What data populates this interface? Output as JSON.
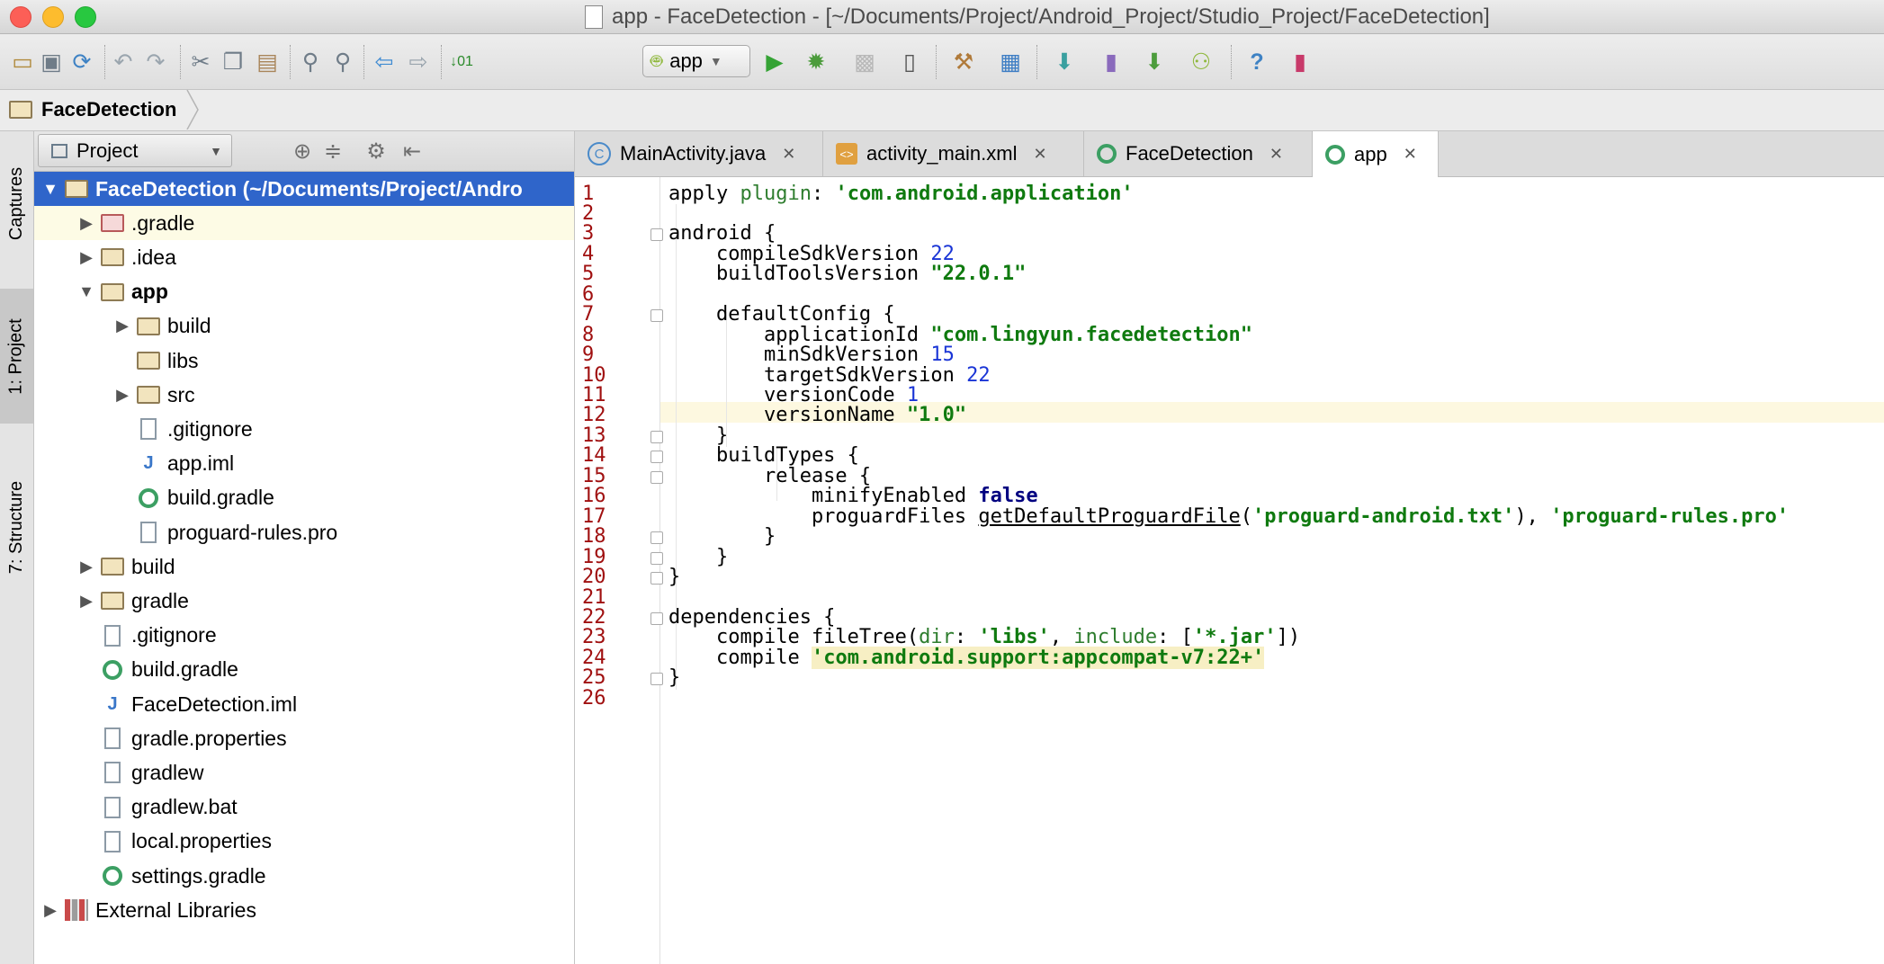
{
  "window": {
    "title": "app - FaceDetection - [~/Documents/Project/Android_Project/Studio_Project/FaceDetection]"
  },
  "toolbar": {
    "run_config": "app",
    "icons": [
      "open-folder-icon",
      "save-icon",
      "sync-icon",
      "undo-icon",
      "redo-icon",
      "cut-icon",
      "copy-icon",
      "paste-icon",
      "find-icon",
      "replace-icon",
      "back-icon",
      "forward-icon",
      "make-project-icon",
      "run-icon",
      "debug-icon",
      "attach-debugger-icon",
      "device-monitor-icon",
      "project-structure-icon",
      "sdk-manager-icon",
      "gradle-sync-icon",
      "avd-manager-icon",
      "sdk-download-icon",
      "android-icon",
      "help-icon",
      "android-device-monitor-icon"
    ]
  },
  "navbar": {
    "breadcrumb": "FaceDetection"
  },
  "side_tabs": [
    "Captures",
    "1: Project",
    "7: Structure"
  ],
  "project_panel": {
    "view_selector": "Project",
    "tree": [
      {
        "label": "FaceDetection (~/Documents/Project/Andro",
        "type": "module",
        "level": 0,
        "expanded": true,
        "selected": true
      },
      {
        "label": ".gradle",
        "type": "folder-red",
        "level": 1,
        "expanded": false
      },
      {
        "label": ".idea",
        "type": "folder",
        "level": 1,
        "expanded": false
      },
      {
        "label": "app",
        "type": "module",
        "level": 1,
        "expanded": true
      },
      {
        "label": "build",
        "type": "folder",
        "level": 2,
        "expanded": false
      },
      {
        "label": "libs",
        "type": "folder",
        "level": 2
      },
      {
        "label": "src",
        "type": "folder",
        "level": 2,
        "expanded": false
      },
      {
        "label": ".gitignore",
        "type": "file",
        "level": 2
      },
      {
        "label": "app.iml",
        "type": "iml",
        "level": 2
      },
      {
        "label": "build.gradle",
        "type": "gradle",
        "level": 2
      },
      {
        "label": "proguard-rules.pro",
        "type": "file",
        "level": 2
      },
      {
        "label": "build",
        "type": "folder",
        "level": 1,
        "expanded": false
      },
      {
        "label": "gradle",
        "type": "folder",
        "level": 1,
        "expanded": false
      },
      {
        "label": ".gitignore",
        "type": "file",
        "level": 1
      },
      {
        "label": "build.gradle",
        "type": "gradle",
        "level": 1
      },
      {
        "label": "FaceDetection.iml",
        "type": "iml",
        "level": 1
      },
      {
        "label": "gradle.properties",
        "type": "file",
        "level": 1
      },
      {
        "label": "gradlew",
        "type": "file",
        "level": 1
      },
      {
        "label": "gradlew.bat",
        "type": "file",
        "level": 1
      },
      {
        "label": "local.properties",
        "type": "file",
        "level": 1
      },
      {
        "label": "settings.gradle",
        "type": "gradle",
        "level": 1
      },
      {
        "label": "External Libraries",
        "type": "ext",
        "level": 0,
        "expanded": false
      }
    ]
  },
  "editor_tabs": [
    {
      "label": "MainActivity.java",
      "icon": "C",
      "active": false
    },
    {
      "label": "activity_main.xml",
      "icon": "xml",
      "active": false
    },
    {
      "label": "FaceDetection",
      "icon": "gradle",
      "active": false
    },
    {
      "label": "app",
      "icon": "gradle",
      "active": true
    }
  ],
  "editor": {
    "current_line": 12,
    "lines": [
      {
        "n": "1",
        "t": "apply plugin: 'com.android.application'"
      },
      {
        "n": "2",
        "t": ""
      },
      {
        "n": "3",
        "t": "android {"
      },
      {
        "n": "4",
        "t": "    compileSdkVersion 22"
      },
      {
        "n": "5",
        "t": "    buildToolsVersion \"22.0.1\""
      },
      {
        "n": "6",
        "t": ""
      },
      {
        "n": "7",
        "t": "    defaultConfig {"
      },
      {
        "n": "8",
        "t": "        applicationId \"com.lingyun.facedetection\""
      },
      {
        "n": "9",
        "t": "        minSdkVersion 15"
      },
      {
        "n": "10",
        "t": "        targetSdkVersion 22"
      },
      {
        "n": "11",
        "t": "        versionCode 1"
      },
      {
        "n": "12",
        "t": "        versionName \"1.0\""
      },
      {
        "n": "13",
        "t": "    }"
      },
      {
        "n": "14",
        "t": "    buildTypes {"
      },
      {
        "n": "15",
        "t": "        release {"
      },
      {
        "n": "16",
        "t": "            minifyEnabled false"
      },
      {
        "n": "17",
        "t": "            proguardFiles getDefaultProguardFile('proguard-android.txt'), 'proguard-rules.pro'"
      },
      {
        "n": "18",
        "t": "        }"
      },
      {
        "n": "19",
        "t": "    }"
      },
      {
        "n": "20",
        "t": "}"
      },
      {
        "n": "21",
        "t": ""
      },
      {
        "n": "22",
        "t": "dependencies {"
      },
      {
        "n": "23",
        "t": "    compile fileTree(dir: 'libs', include: ['*.jar'])"
      },
      {
        "n": "24",
        "t": "    compile 'com.android.support:appcompat-v7:22+'"
      },
      {
        "n": "25",
        "t": "}"
      },
      {
        "n": "26",
        "t": ""
      }
    ]
  }
}
